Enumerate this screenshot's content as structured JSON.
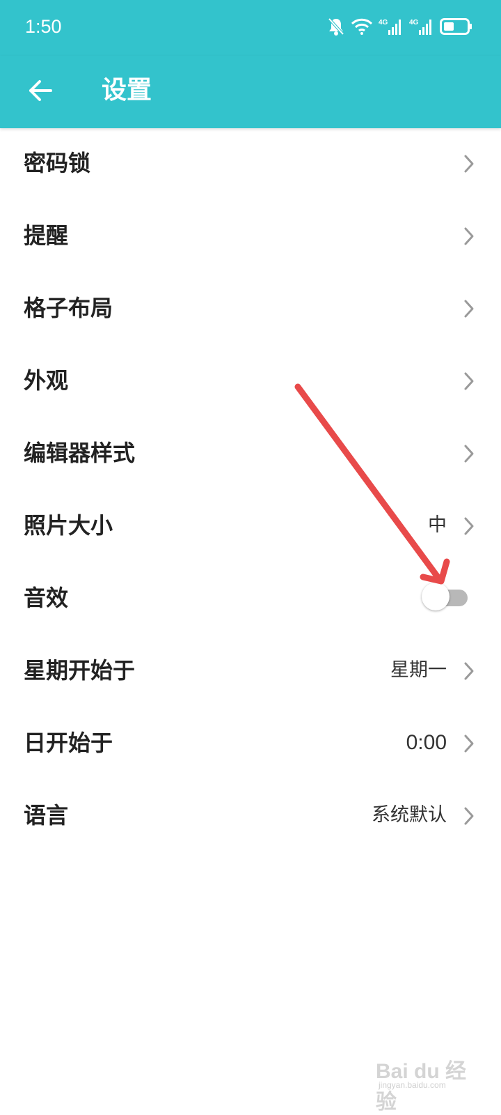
{
  "status_bar": {
    "time": "1:50",
    "icons": [
      "mute-bell-icon",
      "wifi-icon",
      "signal-4g-icon",
      "signal-4g-icon",
      "battery-icon"
    ]
  },
  "app_bar": {
    "title": "设置",
    "back_icon": "arrow-left-icon",
    "background": "#33c3cc"
  },
  "settings": [
    {
      "label": "密码锁",
      "value": "",
      "control": "chevron"
    },
    {
      "label": "提醒",
      "value": "",
      "control": "chevron"
    },
    {
      "label": "格子布局",
      "value": "",
      "control": "chevron"
    },
    {
      "label": "外观",
      "value": "",
      "control": "chevron"
    },
    {
      "label": "编辑器样式",
      "value": "",
      "control": "chevron"
    },
    {
      "label": "照片大小",
      "value": "中",
      "control": "chevron"
    },
    {
      "label": "音效",
      "value": "",
      "control": "toggle",
      "toggle_on": false
    },
    {
      "label": "星期开始于",
      "value": "星期一",
      "control": "chevron"
    },
    {
      "label": "日开始于",
      "value": "0:00",
      "control": "chevron"
    },
    {
      "label": "语言",
      "value": "系统默认",
      "control": "chevron"
    }
  ],
  "annotation": {
    "type": "arrow",
    "color": "#e84a4a",
    "points_to": "音效"
  },
  "watermark": {
    "text": "Bai du 经验",
    "sub": "jingyan.baidu.com"
  }
}
